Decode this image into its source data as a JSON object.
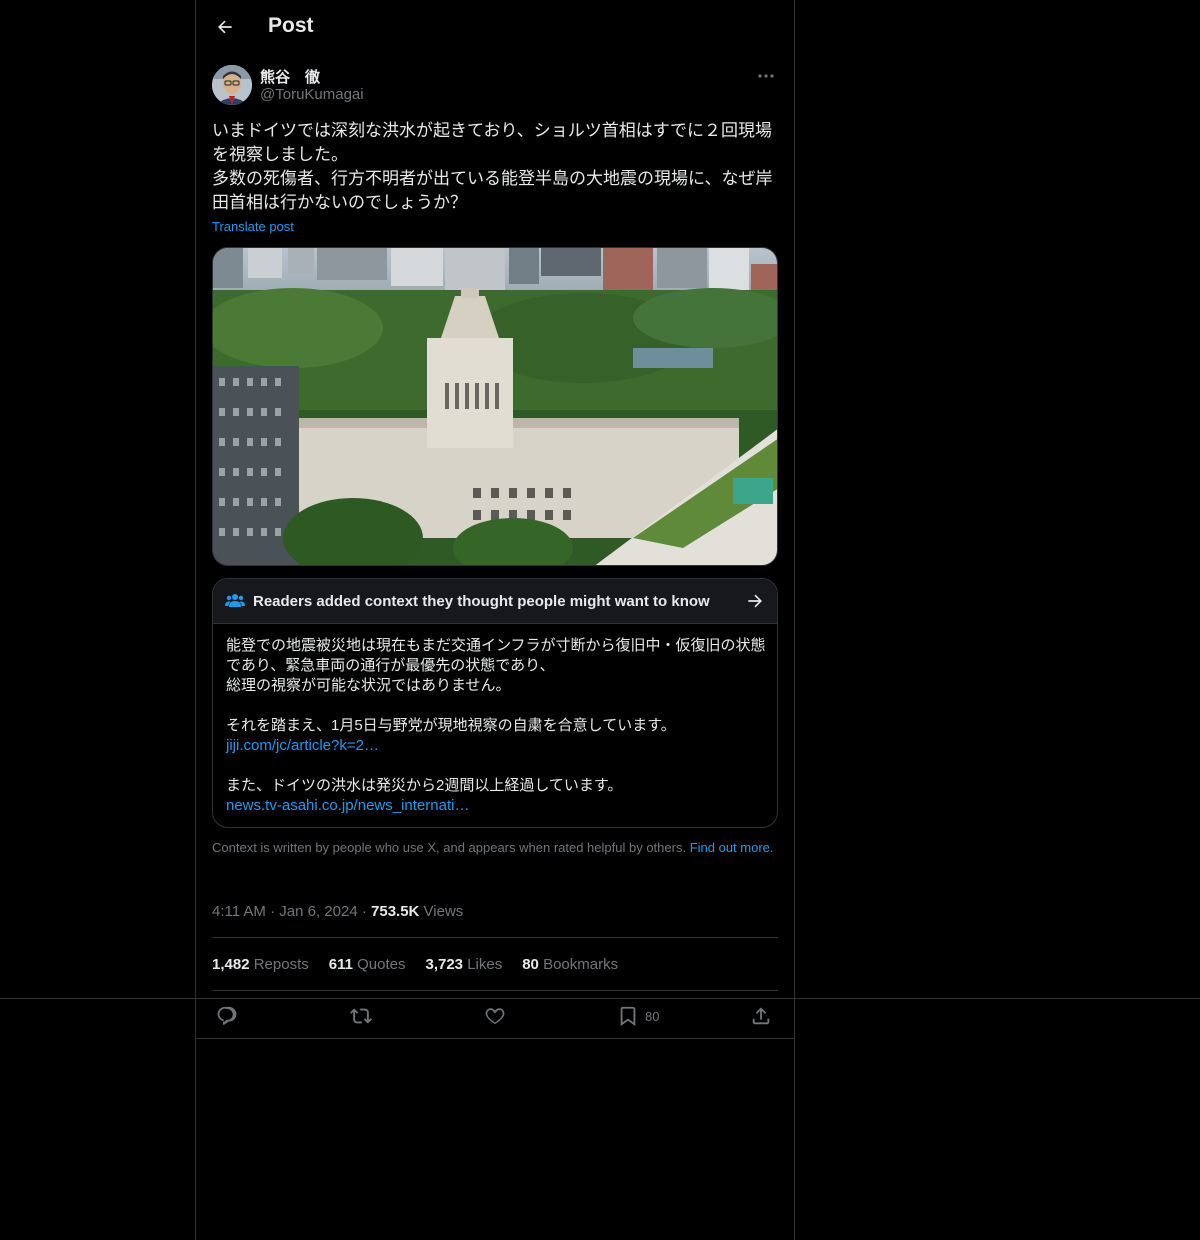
{
  "header": {
    "title": "Post"
  },
  "author": {
    "display_name": "熊谷　徹",
    "handle": "@ToruKumagai"
  },
  "post": {
    "text": "いまドイツでは深刻な洪水が起きており、ショルツ首相はすでに２回現場を視察しました。\n多数の死傷者、行方不明者が出ている能登半島の大地震の現場に、なぜ岸田首相は行かないのでしょうか？",
    "translate_label": "Translate post"
  },
  "note": {
    "title": "Readers added context they thought people might want to know",
    "para1_line1": "能登での地震被災地は現在もまだ交通インフラが寸断から復旧中・仮復旧の状態",
    "para1_line2": "であり、緊急車両の通行が最優先の状態であり、",
    "para1_line3": "総理の視察が可能な状況ではありません。",
    "para2": "それを踏まえ、1月5日与野党が現地視察の自粛を合意しています。",
    "link1": "jiji.com/jc/article?k=2…",
    "para3": "また、ドイツの洪水は発災から2週間以上経過しています。",
    "link2": "news.tv-asahi.co.jp/news_internati…"
  },
  "note_footer": {
    "text": "Context is written by people who use X, and appears when rated helpful by others. ",
    "link": "Find out more."
  },
  "meta": {
    "time": "4:11 AM",
    "sep": " · ",
    "date": "Jan 6, 2024",
    "views_count": "753.5K",
    "views_label": " Views"
  },
  "stats": {
    "reposts_count": "1,482",
    "reposts_label": " Reposts",
    "quotes_count": "611",
    "quotes_label": " Quotes",
    "likes_count": "3,723",
    "likes_label": " Likes",
    "bookmarks_count": "80",
    "bookmarks_label": " Bookmarks"
  },
  "actions": {
    "bookmark_count": "80"
  },
  "colors": {
    "accent": "#1d9bf0",
    "border": "#2f3336",
    "muted": "#71767b",
    "text": "#e7e9ea"
  },
  "icons": [
    "back-arrow-icon",
    "more-icon",
    "readers-icon",
    "chevron-right-arrow-icon",
    "reply-icon",
    "repost-icon",
    "like-icon",
    "bookmark-icon",
    "share-icon"
  ]
}
